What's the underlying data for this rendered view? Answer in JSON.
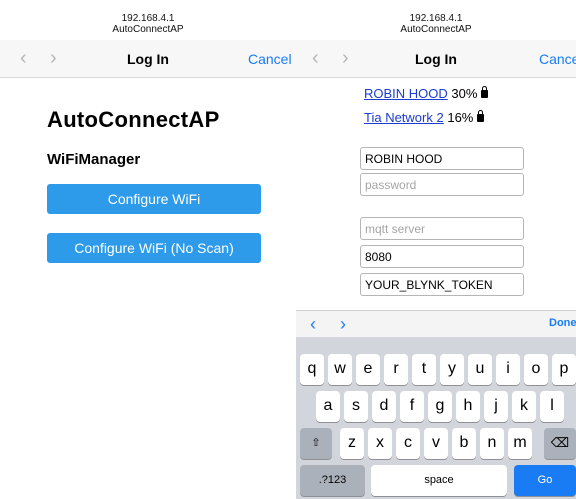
{
  "left": {
    "address": "192.168.4.1",
    "site": "AutoConnectAP",
    "title": "Log In",
    "cancel": "Cancel",
    "back_icon": "chevron-left-icon",
    "forward_icon": "chevron-right-icon",
    "heading": "AutoConnectAP",
    "subheading": "WiFiManager",
    "buttons": [
      "Configure WiFi",
      "Configure WiFi (No Scan)"
    ]
  },
  "right": {
    "address": "192.168.4.1",
    "site": "AutoConnectAP",
    "title": "Log In",
    "cancel": "Cance",
    "networks": [
      {
        "name": "ROBIN HOOD",
        "strength": "30%",
        "secured": true
      },
      {
        "name": "Tia Network 2",
        "strength": "16%",
        "secured": true
      }
    ],
    "fields": {
      "ssid": {
        "value": "ROBIN HOOD",
        "placeholder": ""
      },
      "password": {
        "value": "",
        "placeholder": "password"
      },
      "mqtt_server": {
        "value": "",
        "placeholder": "mqtt server"
      },
      "port": {
        "value": "8080",
        "placeholder": ""
      },
      "token": {
        "value": "YOUR_BLYNK_TOKEN",
        "placeholder": ""
      }
    },
    "keyboard": {
      "done": "Done",
      "rows": [
        [
          "q",
          "w",
          "e",
          "r",
          "t",
          "y",
          "u",
          "i",
          "o",
          "p"
        ],
        [
          "a",
          "s",
          "d",
          "f",
          "g",
          "h",
          "j",
          "k",
          "l"
        ],
        [
          "z",
          "x",
          "c",
          "v",
          "b",
          "n",
          "m"
        ]
      ],
      "shift_icon": "shift-arrow-icon",
      "delete_icon": "backspace-icon",
      "numbers": ".?123",
      "space": "space",
      "go": "Go"
    }
  },
  "colors": {
    "button_blue": "#2d9be9",
    "link_blue": "#1a3ccf",
    "ios_blue": "#1a7cf5",
    "keyboard_bg": "#d2d5db"
  }
}
